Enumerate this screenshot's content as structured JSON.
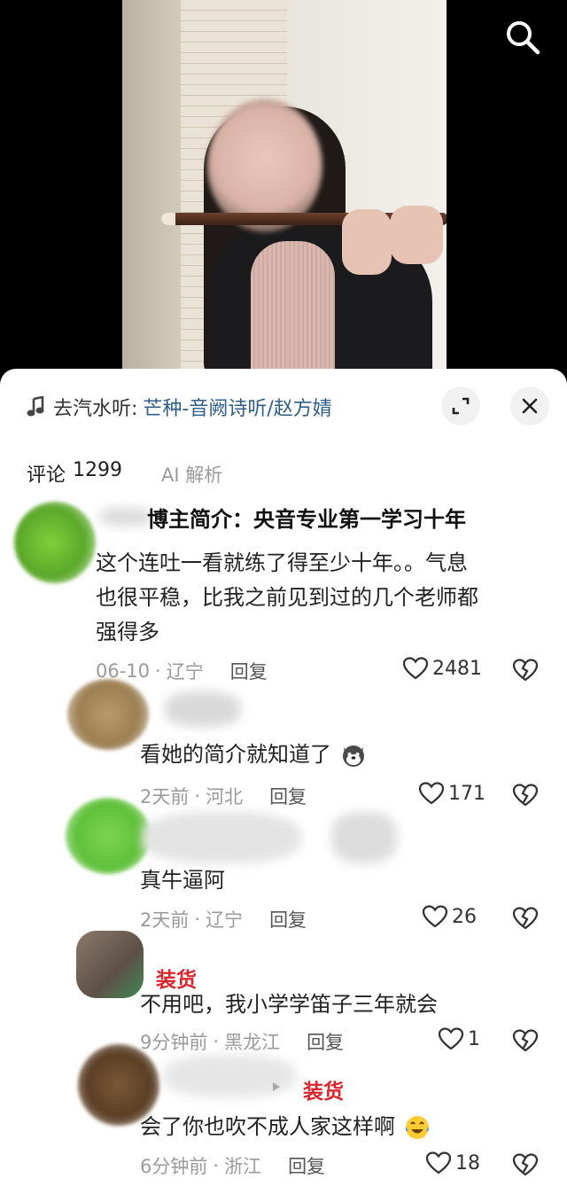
{
  "video": {
    "search_icon": "search-icon"
  },
  "music": {
    "prefix": "去汽水听:",
    "title": "芒种-音阙诗听/赵方婧",
    "icon": "music-note-icon"
  },
  "tabs": {
    "comments_label": "评论",
    "comments_count": "1299",
    "ai_label": "AI 解析"
  },
  "comments": [
    {
      "bio": "博主简介：央音专业第一学习十年",
      "text_lines": [
        "这个连吐一看就练了得至少十年。。气息",
        "也很平稳，比我之前见到过的几个老师都",
        "强得多"
      ],
      "time": "06-10",
      "location": "辽宁",
      "reply_label": "回复",
      "likes": "2481"
    },
    {
      "text": "看她的简介就知道了",
      "time": "2天前",
      "location": "河北",
      "reply_label": "回复",
      "likes": "171"
    },
    {
      "text": "真牛逼阿",
      "time": "2天前",
      "location": "辽宁",
      "reply_label": "回复",
      "likes": "26"
    },
    {
      "name": "装货",
      "text": "不用吧，我小学学笛子三年就会",
      "time": "9分钟前",
      "location": "黑龙江",
      "reply_label": "回复",
      "likes": "1"
    },
    {
      "name": "装货",
      "text": "会了你也吹不成人家这样啊",
      "time": "6分钟前",
      "location": "浙江",
      "reply_label": "回复",
      "likes": "18"
    }
  ],
  "colors": {
    "accent_link": "#2f5e8a",
    "name_red": "#d9252c",
    "meta_gray": "#9a9a9a"
  }
}
